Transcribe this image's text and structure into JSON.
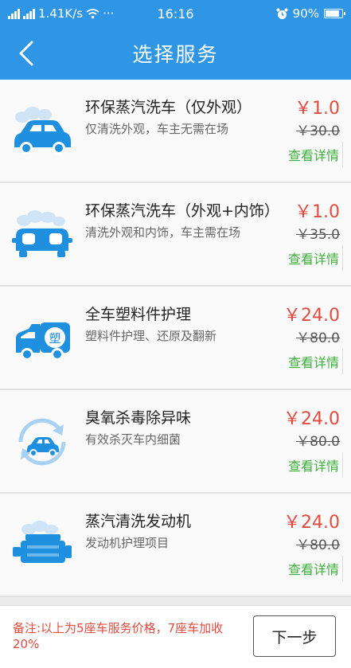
{
  "status_bar": {
    "net_speed": "1.41K/s",
    "more": "···",
    "time": "16:16",
    "battery": "90%",
    "alarm_icon": "alarm-clock-icon"
  },
  "nav": {
    "title": "选择服务",
    "back_icon": "chevron-left-icon"
  },
  "services": [
    {
      "name": "环保蒸汽洗车（仅外观）",
      "desc": "仅清洗外观，车主无需在场",
      "price": "￥1.0",
      "original_price": "￥30.0",
      "detail": "查看详情",
      "icon": "car-wash-icon"
    },
    {
      "name": "环保蒸汽洗车（外观+内饰）",
      "desc": "清洗外观和内饰，车主需在场",
      "price": "￥1.0",
      "original_price": "￥35.0",
      "detail": "查看详情",
      "icon": "car-interior-icon"
    },
    {
      "name": "全车塑料件护理",
      "desc": "塑料件护理、还原及翻新",
      "price": "￥24.0",
      "original_price": "￥80.0",
      "detail": "查看详情",
      "icon": "plastic-care-truck-icon",
      "icon_text": "塑"
    },
    {
      "name": "臭氧杀毒除异味",
      "desc": "有效杀灭车内细菌",
      "price": "￥24.0",
      "original_price": "￥80.0",
      "detail": "查看详情",
      "icon": "ozone-refresh-car-icon"
    },
    {
      "name": "蒸汽清洗发动机",
      "desc": "发动机护理项目",
      "price": "￥24.0",
      "original_price": "￥80.0",
      "detail": "查看详情",
      "icon": "engine-icon"
    }
  ],
  "footer": {
    "note": "备注:以上为5座车服务价格，7座车加收20%",
    "next_label": "下一步"
  },
  "colors": {
    "header": "#2e96e5",
    "icon_blue": "#1f8fe0",
    "price_red": "#e24b3f",
    "detail_green": "#3fae3f"
  }
}
